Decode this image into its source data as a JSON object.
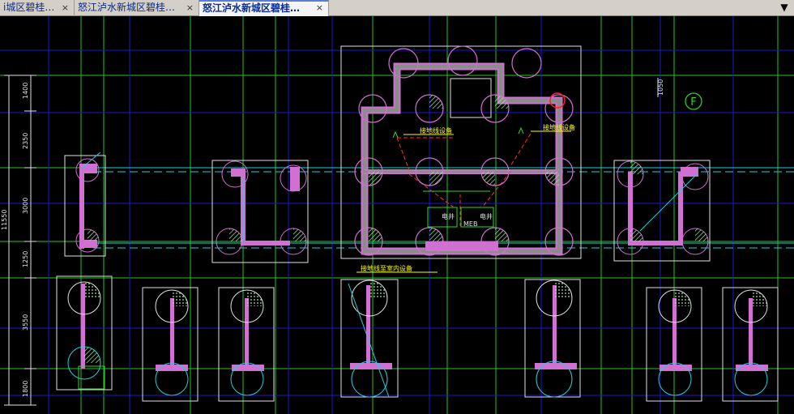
{
  "tabs": [
    {
      "label": "i城区碧桂…",
      "close": "×"
    },
    {
      "label": "怒江泸水新城区碧桂…",
      "close": "×"
    },
    {
      "label": "怒江泸水新城区碧桂…",
      "close": "×",
      "active": true
    }
  ],
  "dropdown_icon": "chevron-down-icon",
  "dimensions": {
    "left": [
      "1400",
      "2350",
      "3000",
      "1250",
      "3550",
      "1800"
    ],
    "total": "11550",
    "top_right": "1050"
  },
  "axis_label": "F",
  "annotations": {
    "left_equip": "接地线设备",
    "right_equip": "接地线设备",
    "bottom_equip": "接地线至室内设备",
    "box_left": "电井",
    "box_right": "电井",
    "meb": "MEB"
  },
  "colors": {
    "background": "#000000",
    "column": "#d070d0",
    "grid": "#2bd82b",
    "axis": "#1a1ad0",
    "dim": "#e0e0e0",
    "beam": "#20d0e0",
    "hatch": "#a0f0a0",
    "text": "#ffff00"
  }
}
